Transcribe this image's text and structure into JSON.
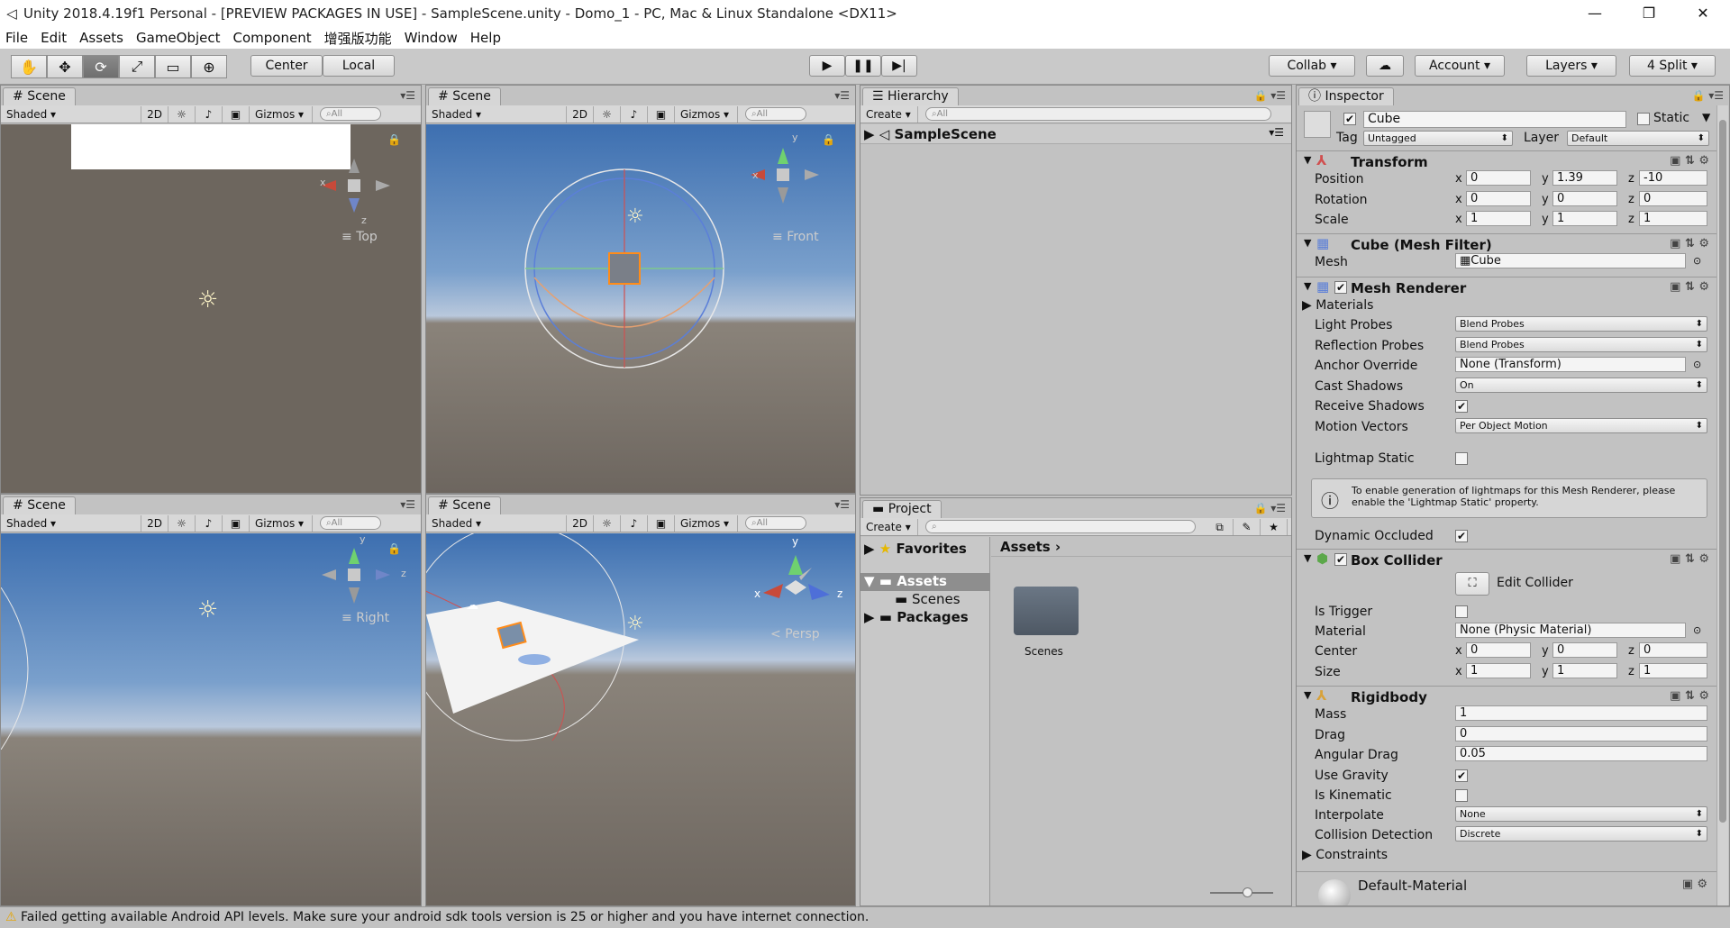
{
  "window": {
    "title": "Unity 2018.4.19f1 Personal - [PREVIEW PACKAGES IN USE] - SampleScene.unity - Domo_1 - PC, Mac & Linux Standalone <DX11>",
    "minimize": "—",
    "restore": "❐",
    "close": "✕"
  },
  "menu": [
    "File",
    "Edit",
    "Assets",
    "GameObject",
    "Component",
    "增强版功能",
    "Window",
    "Help"
  ],
  "toolbar": {
    "tools": [
      "✋",
      "✥",
      "⟳",
      "⤢",
      "▭",
      "⊕"
    ],
    "center": "Center",
    "local": "Local",
    "play": "▶",
    "pause": "❚❚",
    "step": "▶|",
    "collab": "Collab",
    "cloud": "☁",
    "account": "Account",
    "layers": "Layers",
    "layout": "4 Split"
  },
  "scene": {
    "tab": "Scene",
    "shaded": "Shaded",
    "two_d": "2D",
    "gizmos": "Gizmos",
    "search": "All",
    "labels": {
      "top": "Top",
      "front": "Front",
      "right": "Right",
      "persp": "Persp"
    },
    "axes": {
      "x": "x",
      "y": "y",
      "z": "z"
    }
  },
  "hierarchy": {
    "tab": "Hierarchy",
    "create": "Create",
    "search": "All",
    "scene_name": "SampleScene"
  },
  "project": {
    "tab": "Project",
    "create": "Create",
    "favorites": "Favorites",
    "assets": "Assets",
    "scenes": "Scenes",
    "packages": "Packages",
    "breadcrumb": "Assets",
    "folder_label": "Scenes"
  },
  "inspector": {
    "tab": "Inspector",
    "object_name": "Cube",
    "static": "Static",
    "tag_label": "Tag",
    "tag": "Untagged",
    "layer_label": "Layer",
    "layer": "Default",
    "transform": {
      "title": "Transform",
      "position_label": "Position",
      "position": [
        "0",
        "1.39",
        "-10"
      ],
      "rotation_label": "Rotation",
      "rotation": [
        "0",
        "0",
        "0"
      ],
      "scale_label": "Scale",
      "scale": [
        "1",
        "1",
        "1"
      ]
    },
    "mesh_filter": {
      "title": "Cube (Mesh Filter)",
      "mesh_label": "Mesh",
      "mesh": "Cube"
    },
    "mesh_renderer": {
      "title": "Mesh Renderer",
      "materials": "Materials",
      "light_probes_label": "Light Probes",
      "light_probes": "Blend Probes",
      "reflection_label": "Reflection Probes",
      "reflection": "Blend Probes",
      "anchor_label": "Anchor Override",
      "anchor": "None (Transform)",
      "cast_label": "Cast Shadows",
      "cast": "On",
      "receive_label": "Receive Shadows",
      "motion_label": "Motion Vectors",
      "motion": "Per Object Motion",
      "lightmap_label": "Lightmap Static",
      "info": "To enable generation of lightmaps for this Mesh Renderer, please enable the 'Lightmap Static' property.",
      "dynamic_label": "Dynamic Occluded"
    },
    "box_collider": {
      "title": "Box Collider",
      "edit": "Edit Collider",
      "trigger_label": "Is Trigger",
      "material_label": "Material",
      "material": "None (Physic Material)",
      "center_label": "Center",
      "center": [
        "0",
        "0",
        "0"
      ],
      "size_label": "Size",
      "size": [
        "1",
        "1",
        "1"
      ]
    },
    "rigidbody": {
      "title": "Rigidbody",
      "mass_label": "Mass",
      "mass": "1",
      "drag_label": "Drag",
      "drag": "0",
      "angular_label": "Angular Drag",
      "angular": "0.05",
      "gravity_label": "Use Gravity",
      "kinematic_label": "Is Kinematic",
      "interpolate_label": "Interpolate",
      "interpolate": "None",
      "collision_label": "Collision Detection",
      "collision": "Discrete",
      "constraints": "Constraints"
    },
    "material": "Default-Material"
  },
  "status": "Failed getting available Android API levels. Make sure your android sdk tools version is 25 or higher and you have internet connection."
}
